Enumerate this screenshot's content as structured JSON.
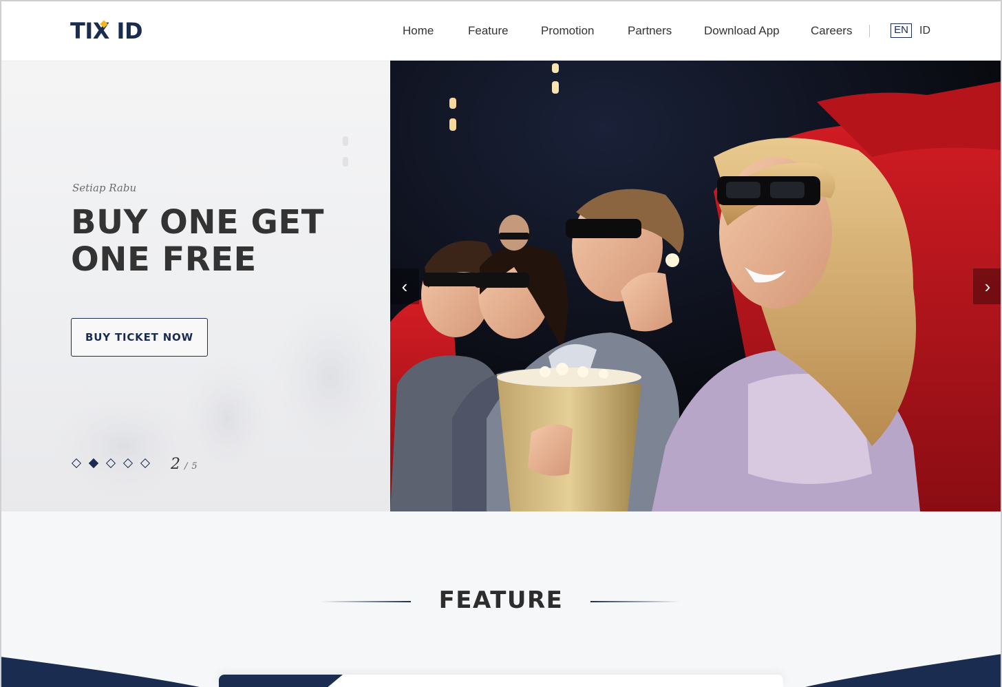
{
  "brand": {
    "logo_text": "TIX ID",
    "primary_color": "#1a2c50",
    "accent_color": "#f2b51c"
  },
  "nav": {
    "items": [
      {
        "label": "Home"
      },
      {
        "label": "Feature"
      },
      {
        "label": "Promotion"
      },
      {
        "label": "Partners"
      },
      {
        "label": "Download App"
      },
      {
        "label": "Careers"
      }
    ],
    "lang_active": "EN",
    "lang_other": "ID"
  },
  "hero": {
    "eyebrow": "Setiap Rabu",
    "headline_line1": "BUY ONE GET",
    "headline_line2": "ONE FREE",
    "cta_label": "BUY TICKET NOW",
    "slide_current": "2",
    "slide_separator": "/",
    "slide_total": "5",
    "slides_count": 5,
    "active_slide": 2,
    "prev_icon": "chevron-left-icon",
    "next_icon": "chevron-right-icon"
  },
  "feature": {
    "title": "FEATURE"
  }
}
